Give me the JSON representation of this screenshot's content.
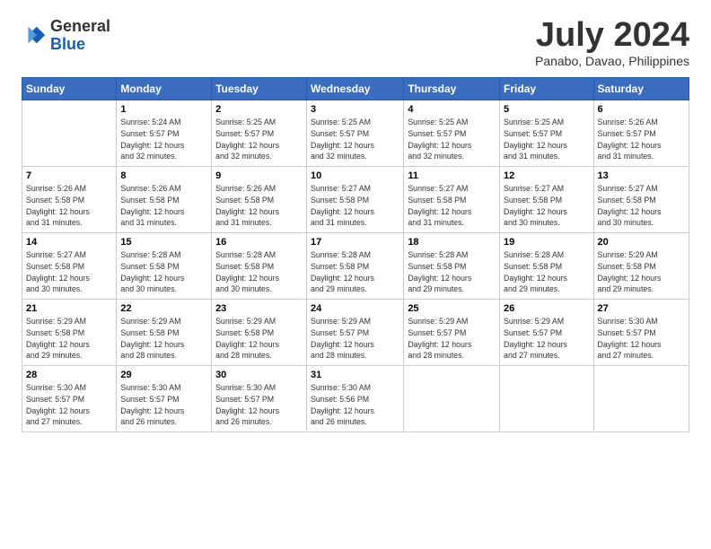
{
  "header": {
    "logo_line1": "General",
    "logo_line2": "Blue",
    "month": "July 2024",
    "location": "Panabo, Davao, Philippines"
  },
  "weekdays": [
    "Sunday",
    "Monday",
    "Tuesday",
    "Wednesday",
    "Thursday",
    "Friday",
    "Saturday"
  ],
  "weeks": [
    [
      {
        "day": "",
        "info": ""
      },
      {
        "day": "1",
        "info": "Sunrise: 5:24 AM\nSunset: 5:57 PM\nDaylight: 12 hours\nand 32 minutes."
      },
      {
        "day": "2",
        "info": "Sunrise: 5:25 AM\nSunset: 5:57 PM\nDaylight: 12 hours\nand 32 minutes."
      },
      {
        "day": "3",
        "info": "Sunrise: 5:25 AM\nSunset: 5:57 PM\nDaylight: 12 hours\nand 32 minutes."
      },
      {
        "day": "4",
        "info": "Sunrise: 5:25 AM\nSunset: 5:57 PM\nDaylight: 12 hours\nand 32 minutes."
      },
      {
        "day": "5",
        "info": "Sunrise: 5:25 AM\nSunset: 5:57 PM\nDaylight: 12 hours\nand 31 minutes."
      },
      {
        "day": "6",
        "info": "Sunrise: 5:26 AM\nSunset: 5:57 PM\nDaylight: 12 hours\nand 31 minutes."
      }
    ],
    [
      {
        "day": "7",
        "info": "Sunrise: 5:26 AM\nSunset: 5:58 PM\nDaylight: 12 hours\nand 31 minutes."
      },
      {
        "day": "8",
        "info": "Sunrise: 5:26 AM\nSunset: 5:58 PM\nDaylight: 12 hours\nand 31 minutes."
      },
      {
        "day": "9",
        "info": "Sunrise: 5:26 AM\nSunset: 5:58 PM\nDaylight: 12 hours\nand 31 minutes."
      },
      {
        "day": "10",
        "info": "Sunrise: 5:27 AM\nSunset: 5:58 PM\nDaylight: 12 hours\nand 31 minutes."
      },
      {
        "day": "11",
        "info": "Sunrise: 5:27 AM\nSunset: 5:58 PM\nDaylight: 12 hours\nand 31 minutes."
      },
      {
        "day": "12",
        "info": "Sunrise: 5:27 AM\nSunset: 5:58 PM\nDaylight: 12 hours\nand 30 minutes."
      },
      {
        "day": "13",
        "info": "Sunrise: 5:27 AM\nSunset: 5:58 PM\nDaylight: 12 hours\nand 30 minutes."
      }
    ],
    [
      {
        "day": "14",
        "info": "Sunrise: 5:27 AM\nSunset: 5:58 PM\nDaylight: 12 hours\nand 30 minutes."
      },
      {
        "day": "15",
        "info": "Sunrise: 5:28 AM\nSunset: 5:58 PM\nDaylight: 12 hours\nand 30 minutes."
      },
      {
        "day": "16",
        "info": "Sunrise: 5:28 AM\nSunset: 5:58 PM\nDaylight: 12 hours\nand 30 minutes."
      },
      {
        "day": "17",
        "info": "Sunrise: 5:28 AM\nSunset: 5:58 PM\nDaylight: 12 hours\nand 29 minutes."
      },
      {
        "day": "18",
        "info": "Sunrise: 5:28 AM\nSunset: 5:58 PM\nDaylight: 12 hours\nand 29 minutes."
      },
      {
        "day": "19",
        "info": "Sunrise: 5:28 AM\nSunset: 5:58 PM\nDaylight: 12 hours\nand 29 minutes."
      },
      {
        "day": "20",
        "info": "Sunrise: 5:29 AM\nSunset: 5:58 PM\nDaylight: 12 hours\nand 29 minutes."
      }
    ],
    [
      {
        "day": "21",
        "info": "Sunrise: 5:29 AM\nSunset: 5:58 PM\nDaylight: 12 hours\nand 29 minutes."
      },
      {
        "day": "22",
        "info": "Sunrise: 5:29 AM\nSunset: 5:58 PM\nDaylight: 12 hours\nand 28 minutes."
      },
      {
        "day": "23",
        "info": "Sunrise: 5:29 AM\nSunset: 5:58 PM\nDaylight: 12 hours\nand 28 minutes."
      },
      {
        "day": "24",
        "info": "Sunrise: 5:29 AM\nSunset: 5:57 PM\nDaylight: 12 hours\nand 28 minutes."
      },
      {
        "day": "25",
        "info": "Sunrise: 5:29 AM\nSunset: 5:57 PM\nDaylight: 12 hours\nand 28 minutes."
      },
      {
        "day": "26",
        "info": "Sunrise: 5:29 AM\nSunset: 5:57 PM\nDaylight: 12 hours\nand 27 minutes."
      },
      {
        "day": "27",
        "info": "Sunrise: 5:30 AM\nSunset: 5:57 PM\nDaylight: 12 hours\nand 27 minutes."
      }
    ],
    [
      {
        "day": "28",
        "info": "Sunrise: 5:30 AM\nSunset: 5:57 PM\nDaylight: 12 hours\nand 27 minutes."
      },
      {
        "day": "29",
        "info": "Sunrise: 5:30 AM\nSunset: 5:57 PM\nDaylight: 12 hours\nand 26 minutes."
      },
      {
        "day": "30",
        "info": "Sunrise: 5:30 AM\nSunset: 5:57 PM\nDaylight: 12 hours\nand 26 minutes."
      },
      {
        "day": "31",
        "info": "Sunrise: 5:30 AM\nSunset: 5:56 PM\nDaylight: 12 hours\nand 26 minutes."
      },
      {
        "day": "",
        "info": ""
      },
      {
        "day": "",
        "info": ""
      },
      {
        "day": "",
        "info": ""
      }
    ]
  ]
}
